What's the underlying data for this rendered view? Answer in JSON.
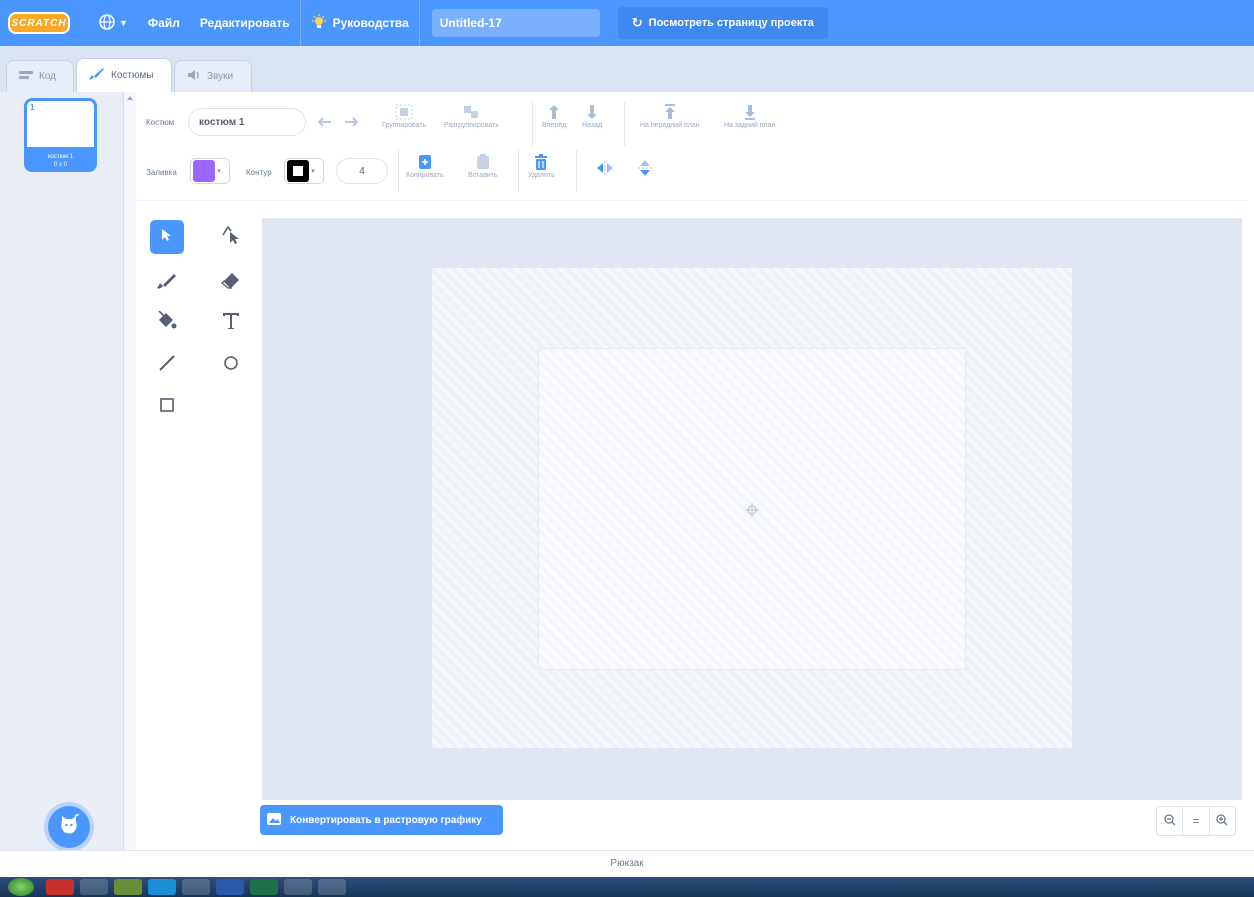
{
  "menu": {
    "logo_text": "SCRATCH",
    "file": "Файл",
    "edit": "Редактировать",
    "tutorials": "Руководства",
    "project_title": "Untitled-17",
    "see_project_page": "Посмотреть страницу проекта"
  },
  "tabs": {
    "code": "Код",
    "costumes": "Костюмы",
    "sounds": "Звуки"
  },
  "costume_list": {
    "items": [
      {
        "number": "1",
        "name": "костюм 1",
        "size": "0 x 0"
      }
    ]
  },
  "editor": {
    "costume_label": "Костюм",
    "costume_name": "костюм 1",
    "group": "Группировать",
    "ungroup": "Разгруппировать",
    "forward": "Вперёд",
    "backward": "Назад",
    "front": "На передний план",
    "back": "На задний план",
    "fill_label": "Заливка",
    "fill_color": "#9966ff",
    "outline_label": "Контур",
    "outline_color": "#000000",
    "outline_width": "4",
    "copy": "Копировать",
    "paste": "Вставить",
    "delete": "Удалить",
    "convert_button": "Конвертировать в растровую графику"
  },
  "zoom": {
    "out": "−",
    "reset": "=",
    "in": "+"
  },
  "backpack": "Рюкзак"
}
